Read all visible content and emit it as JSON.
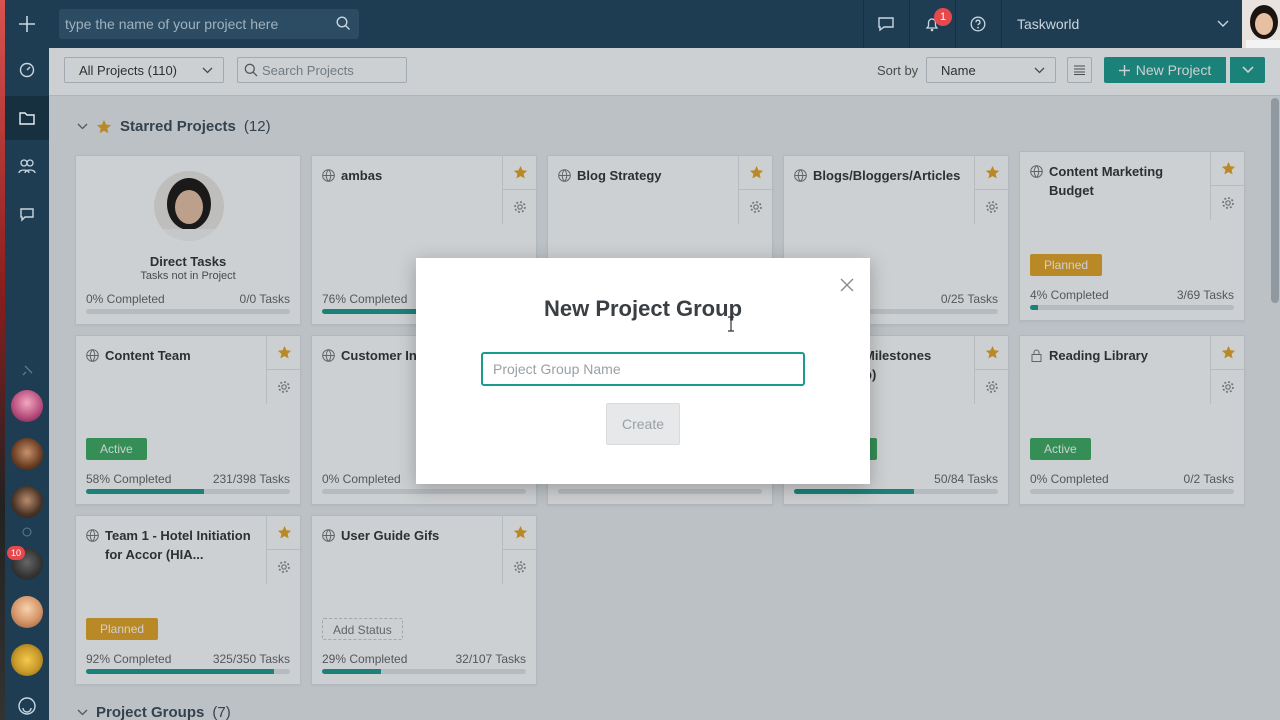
{
  "topbar": {
    "search_placeholder": "type the name of your project here",
    "notification_count": "1",
    "workspace_name": "Taskworld"
  },
  "toolbar": {
    "filter_label": "All Projects (110)",
    "search_placeholder": "Search Projects",
    "sort_label": "Sort by",
    "sort_value": "Name",
    "new_project_label": "New Project"
  },
  "sidebar": {
    "badge_count": "10"
  },
  "sections": {
    "starred_title": "Starred Projects",
    "starred_count": "(12)",
    "groups_title": "Project Groups",
    "groups_count": "(7)"
  },
  "cards": {
    "direct": {
      "title": "Direct Tasks",
      "subtitle": "Tasks not in Project",
      "completed": "0% Completed",
      "tasks": "0/0 Tasks",
      "progress": 0
    },
    "ambas": {
      "title": "ambas",
      "completed": "76% Completed",
      "progress": 76
    },
    "blog_strategy": {
      "title": "Blog Strategy"
    },
    "blogs": {
      "title": "Blogs/Bloggers/Articles",
      "tasks": "0/25 Tasks"
    },
    "cm_budget": {
      "title": "Content Marketing Budget",
      "status": "Planned",
      "completed": "4% Completed",
      "tasks": "3/69 Tasks",
      "progress": 4
    },
    "content_team": {
      "title": "Content Team",
      "status": "Active",
      "completed": "58% Completed",
      "tasks": "231/398 Tasks",
      "progress": 58
    },
    "customer": {
      "title": "Customer In Project",
      "completed": "0% Completed",
      "progress": 0
    },
    "milestones": {
      "title": "Milestones",
      "title2": "p)",
      "tasks": "50/84 Tasks",
      "progress": 59
    },
    "reading": {
      "title": "Reading Library",
      "status": "Active",
      "completed": "0% Completed",
      "tasks": "0/2 Tasks",
      "progress": 0
    },
    "team1": {
      "title": "Team 1 - Hotel Initiation for Accor (HIA...",
      "status": "Planned",
      "completed": "92% Completed",
      "tasks": "325/350 Tasks",
      "progress": 92
    },
    "gifs": {
      "title": "User Guide Gifs",
      "status": "Add Status",
      "completed": "29% Completed",
      "tasks": "32/107 Tasks",
      "progress": 29
    }
  },
  "modal": {
    "title": "New Project Group",
    "input_placeholder": "Project Group Name",
    "create_label": "Create"
  },
  "colors": {
    "accent": "#1a9c8c",
    "sidebar": "#1f3d52",
    "active": "#3bab5f",
    "planned": "#e6a524",
    "star": "#e6a524"
  }
}
